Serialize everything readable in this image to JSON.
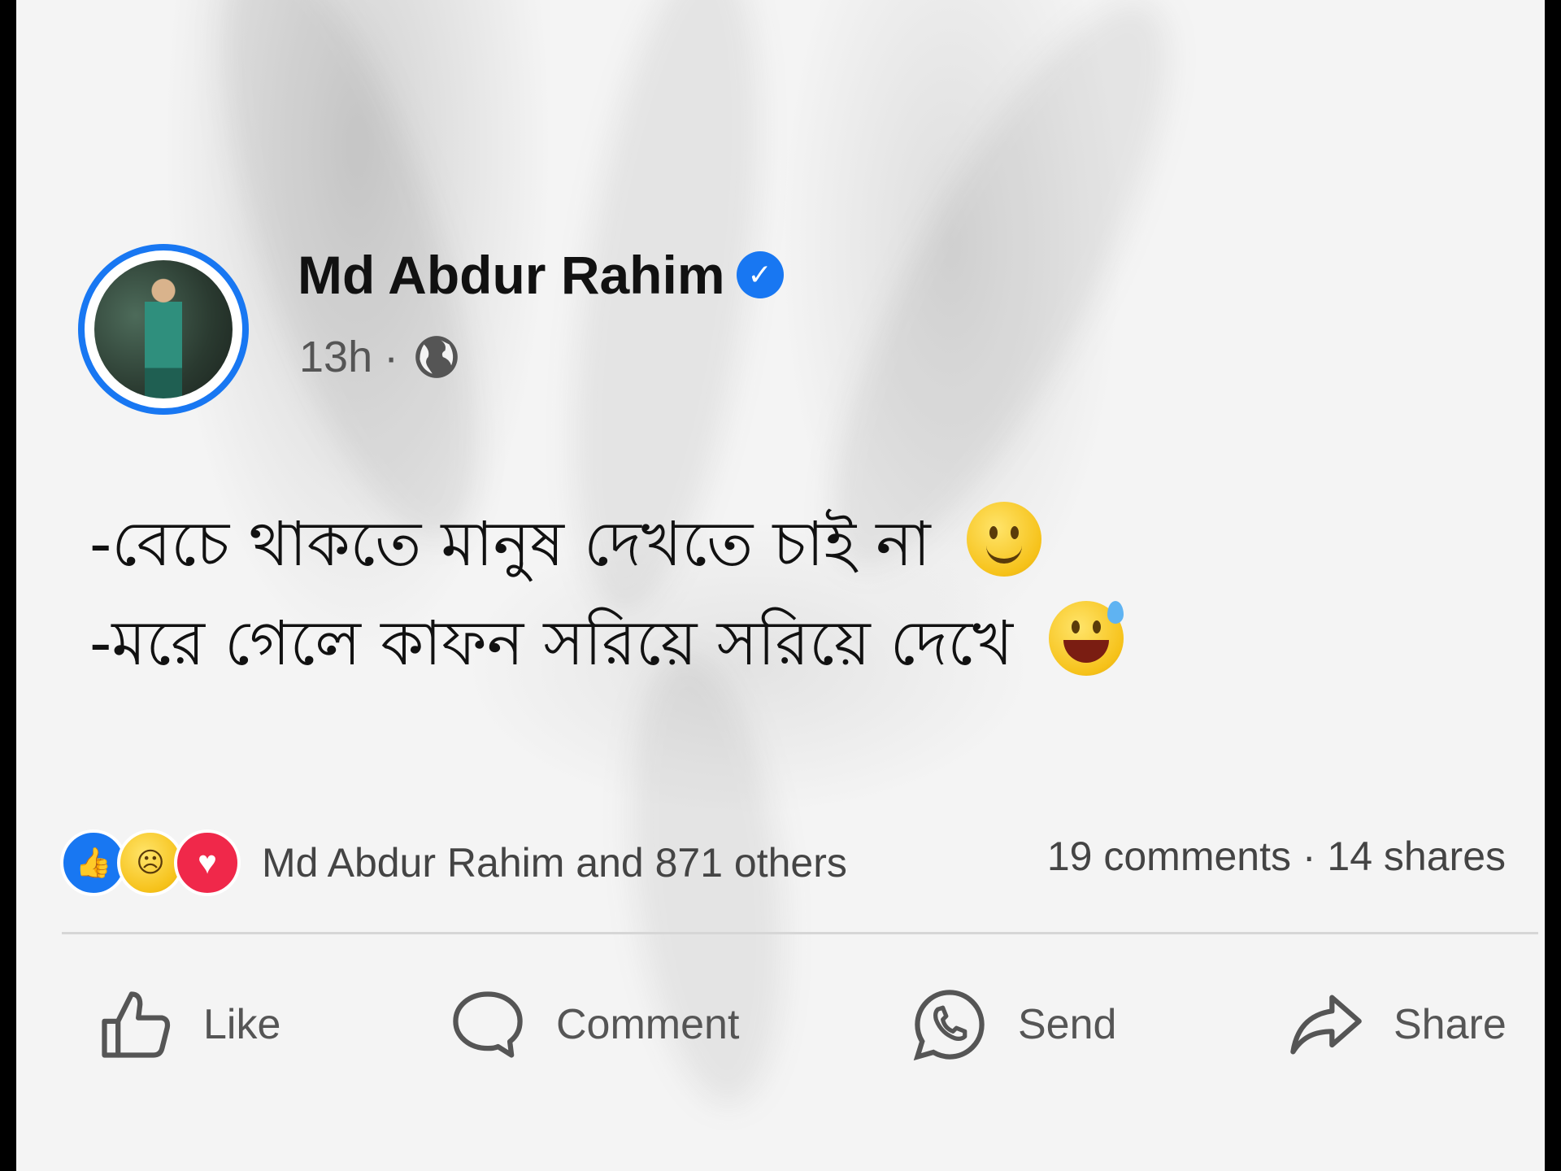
{
  "post": {
    "author_name": "Md Abdur Rahim",
    "time": "13h",
    "separator": "·",
    "lines": [
      "-বেচে থাকতে মানুষ দেখতে চাই না",
      "-মরে গেলে কাফন সরিয়ে সরিয়ে দেখে"
    ]
  },
  "reactions": {
    "summary": "Md Abdur Rahim and 871 others",
    "stats": "19 comments · 14 shares"
  },
  "actions": {
    "like": "Like",
    "comment": "Comment",
    "send": "Send",
    "share": "Share"
  },
  "colors": {
    "accent": "#1877f2",
    "love": "#f0284a"
  }
}
